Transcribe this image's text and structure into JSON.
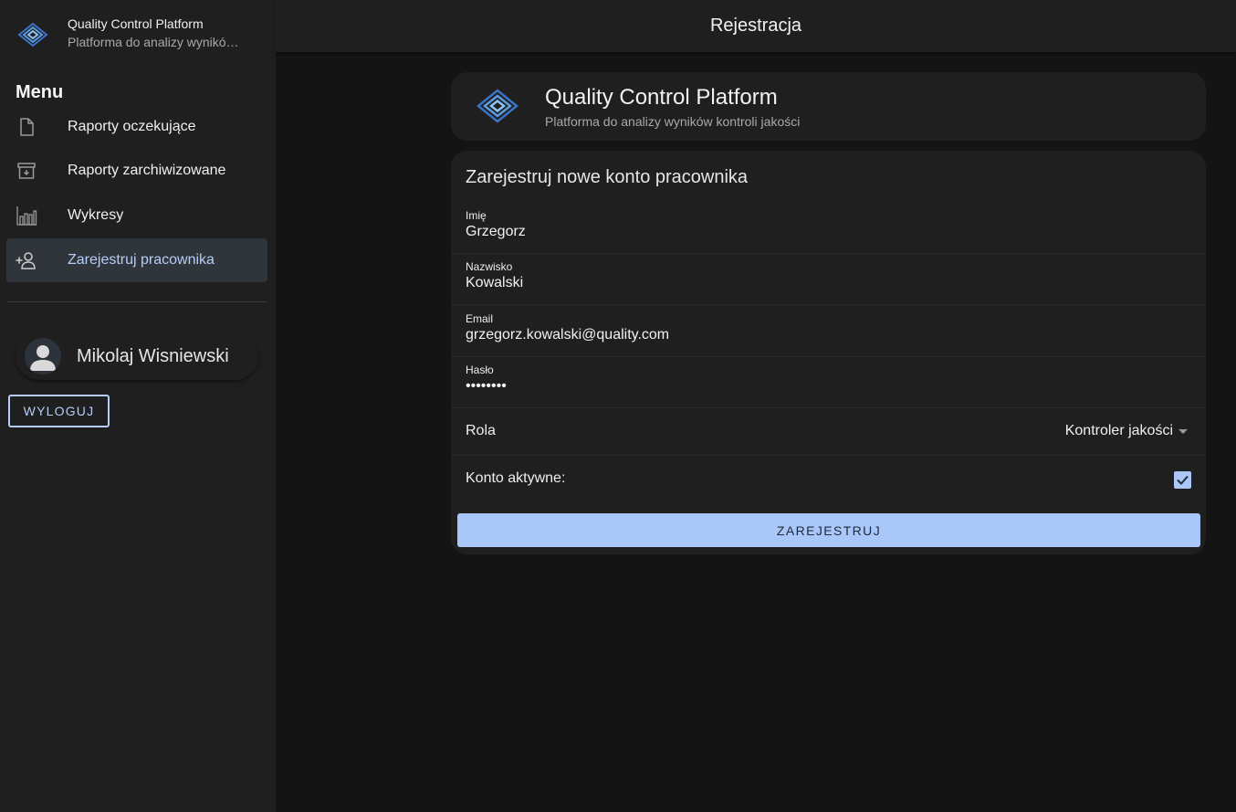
{
  "sidebar": {
    "brand": {
      "name": "Quality Control Platform",
      "tagline": "Platforma do analizy wyników kontroli jakości"
    },
    "menu_title": "Menu",
    "items": [
      {
        "label": "Raporty oczekujące",
        "icon": "file-icon"
      },
      {
        "label": "Raporty zarchiwizowane",
        "icon": "archive-icon"
      },
      {
        "label": "Wykresy",
        "icon": "bar-chart-icon"
      },
      {
        "label": "Zarejestruj pracownika",
        "icon": "add-user-icon",
        "active": true
      }
    ],
    "user": {
      "name": "Mikolaj Wisniewski"
    },
    "logout_label": "WYLOGUJ"
  },
  "topbar": {
    "title": "Rejestracja"
  },
  "header": {
    "title": "Quality Control Platform",
    "subtitle": "Platforma do analizy wyników kontroli jakości"
  },
  "form": {
    "title": "Zarejestruj nowe konto pracownika",
    "fields": {
      "first_name": {
        "label": "Imię",
        "value": "Grzegorz"
      },
      "last_name": {
        "label": "Nazwisko",
        "value": "Kowalski"
      },
      "email": {
        "label": "Email",
        "value": "grzegorz.kowalski@quality.com"
      },
      "password": {
        "label": "Hasło",
        "value": "••••••••"
      }
    },
    "role": {
      "label": "Rola",
      "value": "Kontroler jakości"
    },
    "active": {
      "label": "Konto aktywne:",
      "checked": true
    },
    "submit_label": "ZAREJESTRUJ"
  },
  "colors": {
    "accent": "#aac7fa",
    "sidebar_bg": "#1f1f1f",
    "page_bg": "#141414",
    "active_item_bg": "#30353c"
  }
}
